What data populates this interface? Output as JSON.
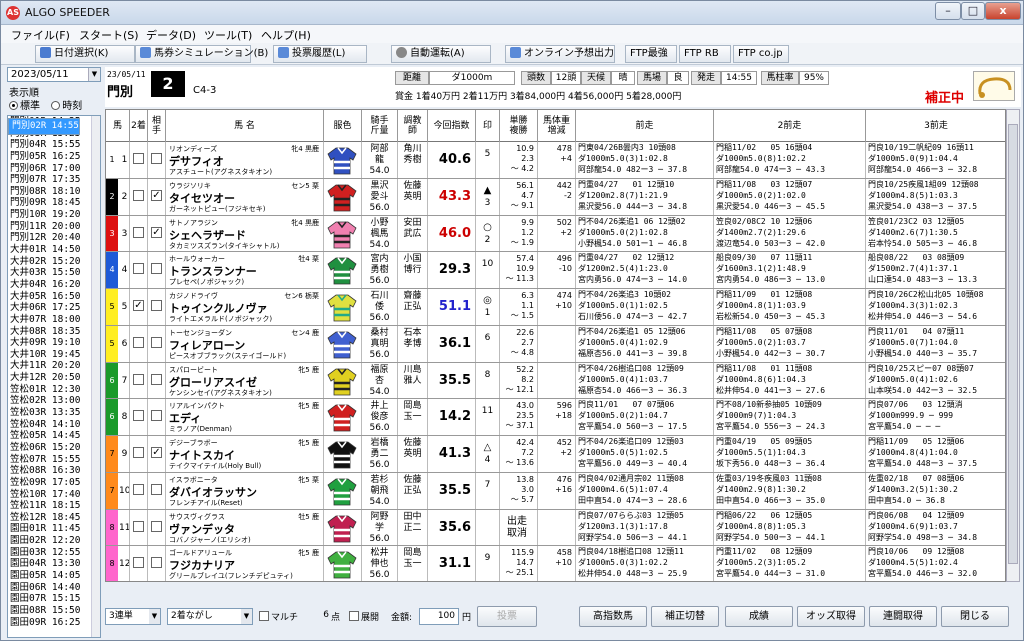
{
  "window": {
    "title": "ALGO SPEEDER",
    "min": "–",
    "max": "□",
    "close": "x"
  },
  "menu": [
    "ファイル(F)",
    "スタート(S)",
    "データ(D)",
    "ツール(T)",
    "ヘルプ(H)"
  ],
  "toolbar": [
    {
      "label": "日付選択(K)",
      "icon": "search-icon",
      "color": "#4a7bd0"
    },
    {
      "label": "馬券シミュレーション(B)",
      "icon": "ticket-icon",
      "color": "#5a8ad8"
    },
    {
      "label": "投票履歴(L)",
      "icon": "history-icon",
      "color": "#5a8ad8"
    },
    {
      "label": "自動運転(A)",
      "icon": "auto-icon",
      "color": "#888"
    },
    {
      "label": "オンライン予想出力",
      "icon": "output-icon",
      "color": "#5a8ad8"
    },
    {
      "label": "FTP最強"
    },
    {
      "label": "FTP RB"
    },
    {
      "label": "FTP co.jp"
    }
  ],
  "left": {
    "date": "2023/05/11",
    "order_label": "表示順",
    "radio_std": "標準",
    "radio_time": "時刻",
    "races": [
      "門別01R 14:25",
      "門別02R 14:55",
      "門別03R 15:25",
      "門別04R 15:55",
      "門別05R 16:25",
      "門別06R 17:00",
      "門別07R 17:35",
      "門別08R 18:10",
      "門別09R 18:45",
      "門別10R 19:20",
      "門別11R 20:00",
      "門別12R 20:40",
      "大井01R 14:50",
      "大井02R 15:20",
      "大井03R 15:50",
      "大井04R 16:20",
      "大井05R 16:50",
      "大井06R 17:25",
      "大井07R 18:00",
      "大井08R 18:35",
      "大井09R 19:10",
      "大井10R 19:45",
      "大井11R 20:20",
      "大井12R 20:50",
      "笠松01R 12:30",
      "笠松02R 13:00",
      "笠松03R 13:35",
      "笠松04R 14:10",
      "笠松05R 14:45",
      "笠松06R 15:20",
      "笠松07R 15:55",
      "笠松08R 16:30",
      "笠松09R 17:05",
      "笠松10R 17:40",
      "笠松11R 18:15",
      "笠松12R 18:45",
      "園田01R 11:45",
      "園田02R 12:20",
      "園田03R 12:55",
      "園田04R 13:30",
      "園田05R 14:05",
      "園田06R 14:40",
      "園田07R 15:15",
      "園田08R 15:50",
      "園田09R 16:25"
    ],
    "selected_index": 1
  },
  "race": {
    "date": "23/05/11",
    "place": "門別",
    "number": "2",
    "class": "C4-3",
    "dist_label": "距離",
    "dist": "ダ1000m",
    "heads_label": "頭数",
    "heads": "12頭",
    "weather_label": "天候",
    "weather": "晴",
    "track_label": "馬場",
    "track": "良",
    "post_label": "発走",
    "post": "14:55",
    "rate_label": "馬柱率",
    "rate": "95%",
    "prizes": "賞金 1着40万円  2着11万円  3着84,000円  4着56,000円  5着28,000円",
    "hosei": "補正中"
  },
  "columns": [
    "馬",
    "2着",
    "相手",
    "馬 名",
    "服色",
    "騎手\n斤量",
    "調教\n師",
    "今回指数",
    "印",
    "単勝\n複勝",
    "馬体重\n増減",
    "前走",
    "2前走",
    "3前走"
  ],
  "horses": [
    {
      "frame": "1",
      "fcolor": "#ffffff",
      "ftext": "#000",
      "num": "1",
      "c2": false,
      "c3": false,
      "sire": "リオンディーズ",
      "sex": "牝4 黒鹿",
      "name": "デサフィオ",
      "dam": "アスチュート(アグネスタキオン)",
      "jockey": "阿部\n龍\n54.0",
      "trainer": "角川\n秀樹",
      "index": "40.6",
      "icolor": "#000",
      "mark": "",
      "place": "5",
      "odds": "10.9\n2.3\n～ 4.2",
      "weight": "478\n+4",
      "silk": [
        "#3050c0",
        "#fff"
      ],
      "p1": "門東04/26B曇内3 10頭08\nダ1000m5.0(3)1:02.8\n阿部龍54.0 482ー3 ─ 37.8",
      "p2": "門稲11/02   05 16頭04\nダ1000m5.0(8)1:02.2\n阿部龍54.0 474ー3 ─ 43.3",
      "p3": "門良10/19二帆紀09 16頭11\nダ1000m5.0(9)1:04.4\n阿部龍54.0 466ー3 ─ 32.8"
    },
    {
      "frame": "2",
      "fcolor": "#000000",
      "ftext": "#fff",
      "num": "2",
      "c2": false,
      "c3": true,
      "sire": "ウラジソリキ",
      "sex": "セン5 栗",
      "name": "タイセツオー",
      "dam": "ガーネットピュー(フジキセキ)",
      "jockey": "黒沢\n愛斗\n56.0",
      "trainer": "佐藤\n英明",
      "index": "43.3",
      "icolor": "#c00",
      "mark": "▲",
      "place": "3",
      "odds": "56.1\n4.7\n～ 9.1",
      "weight": "442\n-2",
      "silk": [
        "#d02020",
        "#222"
      ],
      "p1": "門重04/27   01 12頭10\nダ1200m2.8(7)1:21.9\n黒沢愛56.0 444ー3 ─ 34.8",
      "p2": "門稲11/08   03 12頭07\nダ1000m5.0(2)1:02.0\n黒沢愛54.0 446ー3 ─ 45.5",
      "p3": "門良10/25疾風1組09 12頭08\nダ1000m4.8(5)1:03.3\n黒沢愛54.0 438ー3 ─ 37.5"
    },
    {
      "frame": "3",
      "fcolor": "#dd1111",
      "ftext": "#fff",
      "num": "3",
      "c2": false,
      "c3": true,
      "sire": "サトノアラジン",
      "sex": "牝4 黒鹿",
      "name": "シェヘラザード",
      "dam": "タカミツスズラン(タイキシャトル)",
      "jockey": "小野\n楓馬\n54.0",
      "trainer": "安田\n武広",
      "index": "46.0",
      "icolor": "#c00",
      "mark": "○",
      "place": "2",
      "odds": "9.9\n1.2\n～ 1.9",
      "weight": "502\n+2",
      "silk": [
        "#f080b0",
        "#222"
      ],
      "p1": "門不04/26楽追1 06 12頭02\nダ1000m5.0(2)1:02.8\n小野楓54.0 501ー1 ─ 46.8",
      "p2": "笠良02/08C2 10 12頭06\nダ1400m2.7(2)1:29.6\n渡辺竜54.0 503ー3 ─ 42.0",
      "p3": "笠良01/23C2 03 12頭05\nダ1400m2.6(7)1:30.5\n岩本怜54.0 505ー3 ─ 46.8"
    },
    {
      "frame": "4",
      "fcolor": "#1e5ad7",
      "ftext": "#fff",
      "num": "4",
      "c2": false,
      "c3": false,
      "sire": "ホールウォーカー",
      "sex": "牡4 栗",
      "name": "トランスランナー",
      "dam": "プレセペ(ノボジャック)",
      "jockey": "宮内\n勇樹\n56.0",
      "trainer": "小国\n博行",
      "index": "29.3",
      "icolor": "#000",
      "mark": "",
      "place": "10",
      "odds": "57.4\n10.9\n～ 11.3",
      "weight": "496\n-10",
      "silk": [
        "#209040",
        "#fff"
      ],
      "p1": "門重04/27   02 12頭12\nダ1200m2.5(4)1:23.0\n宮内勇56.0 474ー3 ─ 14.0",
      "p2": "船良09/30   07 11頭11\nダ1600m3.1(2)1:48.9\n宮内勇54.0 486ー3 ─ 13.0",
      "p3": "船良08/22   03 08頭09\nダ1500m2.7(4)1:37.1\n山口達54.0 483ー3 ─ 13.3"
    },
    {
      "frame": "5",
      "fcolor": "#ffee22",
      "ftext": "#000",
      "num": "5",
      "c2": true,
      "c3": false,
      "sire": "カジノドライヴ",
      "sex": "セン6 栃栗",
      "name": "トゥインクルノヴァ",
      "dam": "ライトエメラルド(ノボジャック)",
      "jockey": "石川\n倭\n56.0",
      "trainer": "齋藤\n正弘",
      "index": "51.1",
      "icolor": "#22c",
      "mark": "◎",
      "place": "1",
      "odds": "6.3\n1.1\n～ 1.5",
      "weight": "474\n+10",
      "silk": [
        "#e0e040",
        "#2a8"
      ],
      "p1": "門不04/26楽追3 10頭02\nダ1000m5.0(1)1:02.5\n石川倭56.0 474ー3 ─ 42.7",
      "p2": "門稲11/09   01 12頭08\nダ1000m4.8(1)1:03.9\n岩松新54.0 450ー3 ─ 45.3",
      "p3": "門良10/26C2松山北05 10頭08\nダ1000m4.3(3)1:02.3\n松井伸54.0 446ー3 ─ 54.6"
    },
    {
      "frame": "5",
      "fcolor": "#ffee22",
      "ftext": "#000",
      "num": "6",
      "c2": false,
      "c3": false,
      "sire": "トーセンジョーダン",
      "sex": "セン4 鹿",
      "name": "フィレアローン",
      "dam": "ピースオブブラック(ステイゴールド)",
      "jockey": "桑村\n真明\n56.0",
      "trainer": "石本\n孝博",
      "index": "36.1",
      "icolor": "#000",
      "mark": "",
      "place": "6",
      "odds": "22.6\n2.7\n～ 4.8",
      "weight": "",
      "silk": [
        "#4060d0",
        "#fff"
      ],
      "p1": "門不04/26楽追1 05 12頭06\nダ1000m5.0(4)1:02.9\n福原杏56.0 441ー3 ─ 39.8",
      "p2": "門稲11/08   05 07頭08\nダ1000m5.0(2)1:03.7\n小野楓54.0 442ー3 ─ 30.7",
      "p3": "門良11/01   04 07頭11\nダ1000m5.0(7)1:04.0\n小野楓54.0 440ー3 ─ 35.7"
    },
    {
      "frame": "6",
      "fcolor": "#1a9a2a",
      "ftext": "#fff",
      "num": "7",
      "c2": false,
      "c3": false,
      "sire": "スパロービート",
      "sex": "牝5 鹿",
      "name": "グローリアスイゼ",
      "dam": "ケンシンセイ(アグネスタキオン)",
      "jockey": "福原\n杏\n54.0",
      "trainer": "川島\n雅人",
      "index": "35.5",
      "icolor": "#000",
      "mark": "",
      "place": "8",
      "odds": "52.2\n8.2\n～ 12.1",
      "weight": "",
      "silk": [
        "#e0d020",
        "#222"
      ],
      "p1": "門不04/26樹追口08 12頭09\nダ1000m5.0(4)1:03.7\n福原杏54.0 466ー3 ─ 36.3",
      "p2": "門稲11/08   01 11頭08\nダ1000m4.8(6)1:04.3\n松井伸54.0 441ー3 ─ 27.6",
      "p3": "門良10/25スピー07 08頭07\nダ1000m5.0(4)1:02.6\n山本咲54.0 442ー3 ─ 32.5"
    },
    {
      "frame": "6",
      "fcolor": "#1a9a2a",
      "ftext": "#fff",
      "num": "8",
      "c2": false,
      "c3": false,
      "sire": "リアルインパクト",
      "sex": "牝5 鹿",
      "name": "エディ",
      "dam": "ミラノア(Denman)",
      "jockey": "井上\n俊彦\n56.0",
      "trainer": "岡島\n玉一",
      "index": "14.2",
      "icolor": "#000",
      "mark": "",
      "place": "11",
      "odds": "43.0\n23.5\n～ 37.1",
      "weight": "596\n+18",
      "silk": [
        "#d02020",
        "#fff"
      ],
      "p1": "門良11/01   07 07頭06\nダ1000m5.0(2)1:04.7\n宮平鷹54.0 560ー3 ─ 17.5",
      "p2": "門不08/10新参抽05 10頭09\nダ1000m9(7)1:04.3\n宮平鷹54.0 556ー3 ─ 24.3",
      "p3": "門良07/06   03 12頭消\nダ1000m999.9 ─ 999\n宮平鷹54.0 ─ ─ ─"
    },
    {
      "frame": "7",
      "fcolor": "#ff8a1c",
      "ftext": "#000",
      "num": "9",
      "c2": false,
      "c3": true,
      "sire": "デジーブラボー",
      "sex": "牝5 鹿",
      "name": "ナイトスカイ",
      "dam": "テイクマイテイル(Holy Bull)",
      "jockey": "岩橋\n勇二\n56.0",
      "trainer": "佐藤\n英明",
      "index": "41.3",
      "icolor": "#000",
      "mark": "△",
      "place": "4",
      "odds": "42.4\n7.2\n～ 13.6",
      "weight": "452\n+2",
      "silk": [
        "#111111",
        "#fff"
      ],
      "p1": "門不04/26楽追口09 12頭03\nダ1000m5.0(5)1:02.5\n宮平鷹56.0 449ー3 ─ 40.4",
      "p2": "門重04/19   05 09頭05\nダ1000m5.5(1)1:04.3\n坂下秀56.0 448ー3 ─ 36.4",
      "p3": "門稲11/09   05 12頭06\nダ1000m4.8(4)1:04.0\n宮平鷹54.0 448ー3 ─ 37.5"
    },
    {
      "frame": "7",
      "fcolor": "#ff8a1c",
      "ftext": "#000",
      "num": "10",
      "c2": false,
      "c3": false,
      "sire": "イスラボニータ",
      "sex": "牝5 栗",
      "name": "ダバイオラッサン",
      "dam": "フレンチアイル(Reset)",
      "jockey": "若杉\n朝飛\n54.0",
      "trainer": "佐藤\n正弘",
      "index": "35.5",
      "icolor": "#000",
      "mark": "",
      "place": "7",
      "odds": "13.8\n3.0\n～ 5.7",
      "weight": "476\n+16",
      "silk": [
        "#20a040",
        "#fff"
      ],
      "p1": "門良04/02通月宗02 11頭08\nダ1000m4.6(5)1:07.4\n田中直54.0 474ー3 ─ 28.6",
      "p2": "佐重03/19冬疾風03 11頭08\nダ1400m2.9(8)1:30.2\n田中直54.0 466ー3 ─ 35.0",
      "p3": "佐重02/18   07 08頭06\nダ1400m3.2(5)1:30.2\n田中直54.0 ─ 36.8"
    },
    {
      "frame": "8",
      "fcolor": "#ff66cc",
      "ftext": "#000",
      "num": "11",
      "c2": false,
      "c3": false,
      "sire": "サウスヴィグラス",
      "sex": "牡5 鹿",
      "name": "ヴァンデッタ",
      "dam": "コバノジャーノ(エリシオ)",
      "jockey": "阿野\n学\n56.0",
      "trainer": "田中\n正二",
      "index": "35.6",
      "icolor": "#000",
      "mark": "",
      "place": "",
      "odds": "出走\n取消",
      "weight": "",
      "silk": [
        "#c02050",
        "#fff"
      ],
      "p1": "門良07/07ららぶ03 12頭05\nダ1200m3.1(3)1:17.8\n阿野学54.0 506ー3 ─ 44.1",
      "p2": "門稲06/22   06 12頭05\nダ1000m4.8(8)1:05.3\n阿野学54.0 500ー3 ─ 44.1",
      "p3": "門良06/08   04 12頭09\nダ1000m4.6(9)1:03.7\n阿野学54.0 498ー3 ─ 34.8"
    },
    {
      "frame": "8",
      "fcolor": "#ff66cc",
      "ftext": "#000",
      "num": "12",
      "c2": false,
      "c3": false,
      "sire": "ゴールドアリュール",
      "sex": "牝5 鹿",
      "name": "フジカナリア",
      "dam": "グリールブレイユ(フレンチデピュティ)",
      "jockey": "松井\n伸也\n56.0",
      "trainer": "岡島\n玉一",
      "index": "31.1",
      "icolor": "#000",
      "mark": "",
      "place": "9",
      "odds": "115.9\n14.7\n～ 25.1",
      "weight": "458\n+10",
      "silk": [
        "#40b040",
        "#fff"
      ],
      "p1": "門良04/18樹追口08 12頭11\nダ1000m5.0(3)1:02.2\n松井伸54.0 448ー3 ─ 25.9",
      "p2": "門重11/02   08 12頭09\nダ1000m5.2(3)1:05.2\n宮平鷹54.0 444ー3 ─ 31.0",
      "p3": "門良10/06   09 12頭08\nダ1000m4.5(5)1:02.4\n宮平鷹54.0 446ー3 ─ 32.0"
    }
  ],
  "bottom": {
    "type": "3連単",
    "mode": "2着ながし",
    "multi": "マルチ",
    "points": "6",
    "points_unit": "点",
    "expand": "展開",
    "amount_label": "金額:",
    "amount": "100",
    "amount_unit": "円",
    "vote": "投票",
    "b1": "高指数馬",
    "b2": "補正切替",
    "b3": "成績",
    "b4": "オッズ取得",
    "b5": "連闘取得",
    "b6": "閉じる"
  }
}
